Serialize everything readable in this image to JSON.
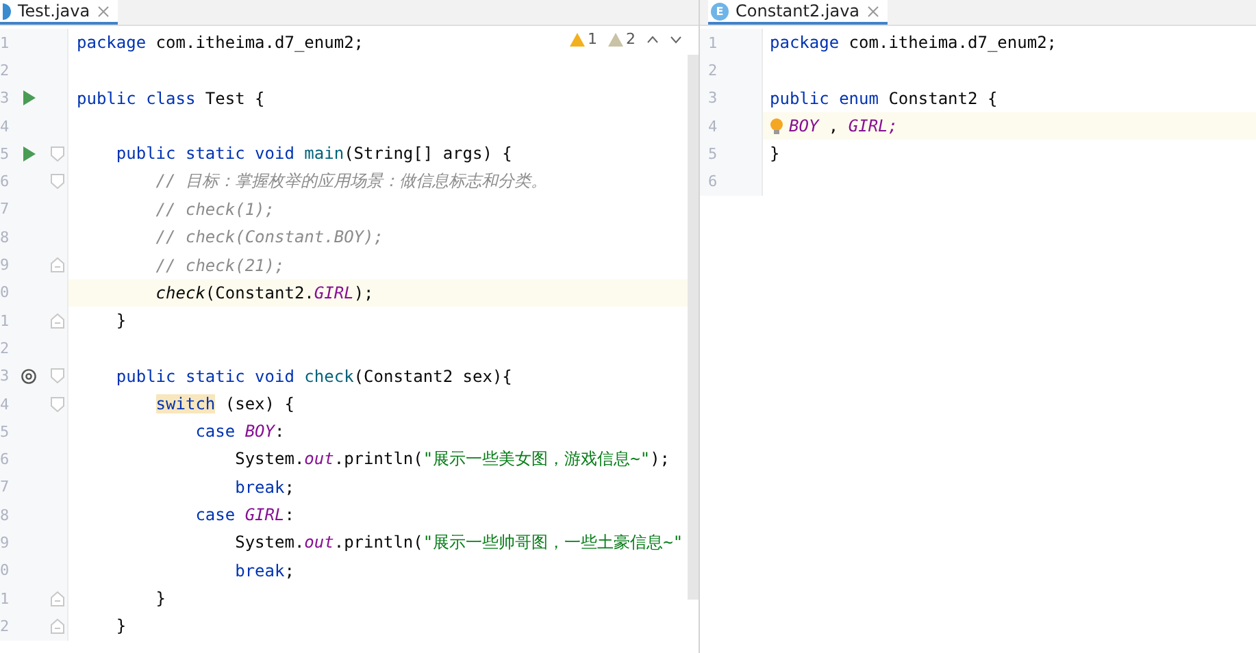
{
  "panes": [
    {
      "tab": {
        "title": "Test.java",
        "kind": "class",
        "selected": true
      },
      "inspections": [
        {
          "kind": "warning",
          "count": "1"
        },
        {
          "kind": "weak",
          "count": "2"
        }
      ],
      "lines": [
        {
          "number": "1",
          "tokens": [
            {
              "kind": "kw",
              "text": "package "
            },
            {
              "kind": "plain",
              "text": "com.itheima.d7_enum2;"
            }
          ]
        },
        {
          "number": "2"
        },
        {
          "number": "3",
          "runnable": true,
          "tokens": [
            {
              "kind": "kw",
              "text": "public class "
            },
            {
              "kind": "plain",
              "text": "Test {"
            }
          ]
        },
        {
          "number": "4"
        },
        {
          "number": "5",
          "runnable": true,
          "fold_start": true,
          "tokens": [
            {
              "kind": "kw",
              "text": "    public static void "
            },
            {
              "kind": "decl",
              "text": "main"
            },
            {
              "kind": "plain",
              "text": "(String[] args) {"
            }
          ]
        },
        {
          "number": "6",
          "fold_start": true,
          "tokens": [
            {
              "kind": "comment",
              "text": "        // 目标：掌握枚举的应用场景：做信息标志和分类。"
            }
          ]
        },
        {
          "number": "7",
          "tokens": [
            {
              "kind": "comment",
              "text": "        // check(1);"
            }
          ]
        },
        {
          "number": "8",
          "tokens": [
            {
              "kind": "comment",
              "text": "        // check(Constant.BOY);"
            }
          ]
        },
        {
          "number": "9",
          "fold_end": true,
          "tokens": [
            {
              "kind": "comment",
              "text": "        // check(21);"
            }
          ]
        },
        {
          "number": "0",
          "highlighted": true,
          "tokens": [
            {
              "kind": "call",
              "text": "        check"
            },
            {
              "kind": "plain",
              "text": "(Constant2."
            },
            {
              "kind": "const",
              "text": "GIRL"
            },
            {
              "kind": "plain",
              "text": ");"
            }
          ]
        },
        {
          "number": "1",
          "fold_end": true,
          "tokens": [
            {
              "kind": "plain",
              "text": "    }"
            }
          ]
        },
        {
          "number": "2"
        },
        {
          "number": "3",
          "overrides": true,
          "fold_start": true,
          "tokens": [
            {
              "kind": "kw",
              "text": "    public static void "
            },
            {
              "kind": "decl",
              "text": "check"
            },
            {
              "kind": "plain",
              "text": "(Constant2 sex){"
            }
          ]
        },
        {
          "number": "4",
          "fold_start": true,
          "tokens": [
            {
              "kind": "kwmark",
              "text": "        switch"
            },
            {
              "kind": "plain",
              "text": " (sex) {"
            }
          ]
        },
        {
          "number": "5",
          "tokens": [
            {
              "kind": "kw",
              "text": "            case "
            },
            {
              "kind": "const",
              "text": "BOY"
            },
            {
              "kind": "plain",
              "text": ":"
            }
          ]
        },
        {
          "number": "6",
          "tokens": [
            {
              "kind": "plain",
              "text": "                System."
            },
            {
              "kind": "const",
              "text": "out"
            },
            {
              "kind": "plain",
              "text": ".println("
            },
            {
              "kind": "str",
              "text": "\"展示一些美女图，游戏信息~\""
            },
            {
              "kind": "plain",
              "text": ");"
            }
          ]
        },
        {
          "number": "7",
          "tokens": [
            {
              "kind": "kw",
              "text": "                break"
            },
            {
              "kind": "plain",
              "text": ";"
            }
          ]
        },
        {
          "number": "8",
          "tokens": [
            {
              "kind": "kw",
              "text": "            case "
            },
            {
              "kind": "const",
              "text": "GIRL"
            },
            {
              "kind": "plain",
              "text": ":"
            }
          ]
        },
        {
          "number": "9",
          "tokens": [
            {
              "kind": "plain",
              "text": "                System."
            },
            {
              "kind": "const",
              "text": "out"
            },
            {
              "kind": "plain",
              "text": ".println("
            },
            {
              "kind": "str",
              "text": "\"展示一些帅哥图，一些土豪信息~\""
            }
          ]
        },
        {
          "number": "0",
          "tokens": [
            {
              "kind": "kw",
              "text": "                break"
            },
            {
              "kind": "plain",
              "text": ";"
            }
          ]
        },
        {
          "number": "1",
          "fold_end": true,
          "tokens": [
            {
              "kind": "plain",
              "text": "        }"
            }
          ]
        },
        {
          "number": "2",
          "fold_end": true,
          "tokens": [
            {
              "kind": "plain",
              "text": "    }"
            }
          ]
        }
      ]
    },
    {
      "tab": {
        "title": "Constant2.java",
        "kind": "enum",
        "icon_glyph": "E",
        "selected": true
      },
      "lines": [
        {
          "number": "1",
          "tokens": [
            {
              "kind": "kw",
              "text": "package "
            },
            {
              "kind": "plain",
              "text": "com.itheima.d7_enum2;"
            }
          ]
        },
        {
          "number": "2"
        },
        {
          "number": "3",
          "tokens": [
            {
              "kind": "kw",
              "text": "public enum "
            },
            {
              "kind": "plain",
              "text": "Constant2 {"
            }
          ]
        },
        {
          "number": "4",
          "highlighted": true,
          "intention_bulb": true,
          "tokens": [
            {
              "kind": "const",
              "text": "BOY"
            },
            {
              "kind": "plain",
              "text": " , "
            },
            {
              "kind": "const",
              "text": "GIRL;"
            }
          ]
        },
        {
          "number": "5",
          "tokens": [
            {
              "kind": "plain",
              "text": "}"
            }
          ]
        },
        {
          "number": "6"
        }
      ]
    }
  ]
}
